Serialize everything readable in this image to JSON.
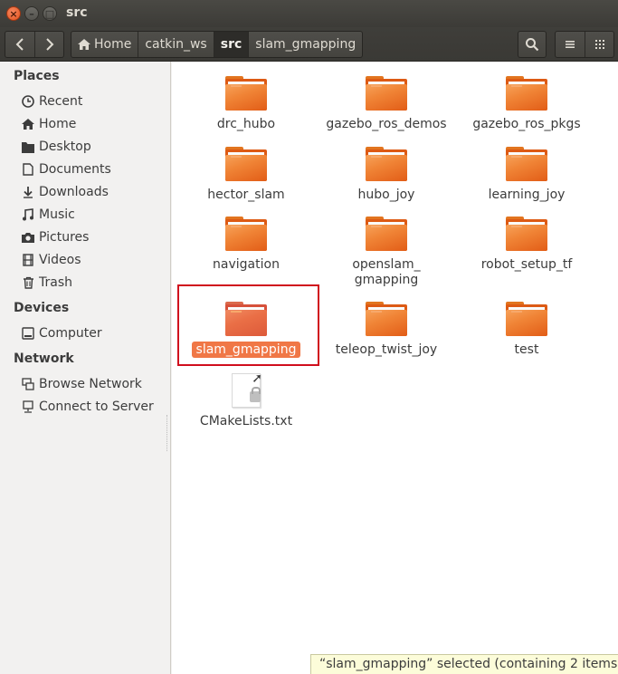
{
  "window": {
    "title": "src"
  },
  "toolbar": {
    "breadcrumbs": [
      "Home",
      "catkin_ws",
      "src",
      "slam_gmapping"
    ]
  },
  "sidebar": {
    "places_heading": "Places",
    "places": [
      "Recent",
      "Home",
      "Desktop",
      "Documents",
      "Downloads",
      "Music",
      "Pictures",
      "Videos",
      "Trash"
    ],
    "devices_heading": "Devices",
    "devices": [
      "Computer"
    ],
    "network_heading": "Network",
    "network": [
      "Browse Network",
      "Connect to Server"
    ]
  },
  "files": {
    "items": [
      "drc_hubo",
      "gazebo_ros_demos",
      "gazebo_ros_pkgs",
      "hector_slam",
      "hubo_joy",
      "learning_joy",
      "navigation",
      "openslam_",
      "robot_setup_tf",
      "slam_gmapping",
      "teleop_twist_joy",
      "test",
      "CMakeLists.txt"
    ],
    "item7_line2": "gmapping"
  },
  "status": {
    "text": "“slam_gmapping” selected  (containing 2 items)"
  },
  "colors": {
    "accent": "#f07746",
    "folder": "#e25d17",
    "highlight_box": "#d00e1d"
  }
}
